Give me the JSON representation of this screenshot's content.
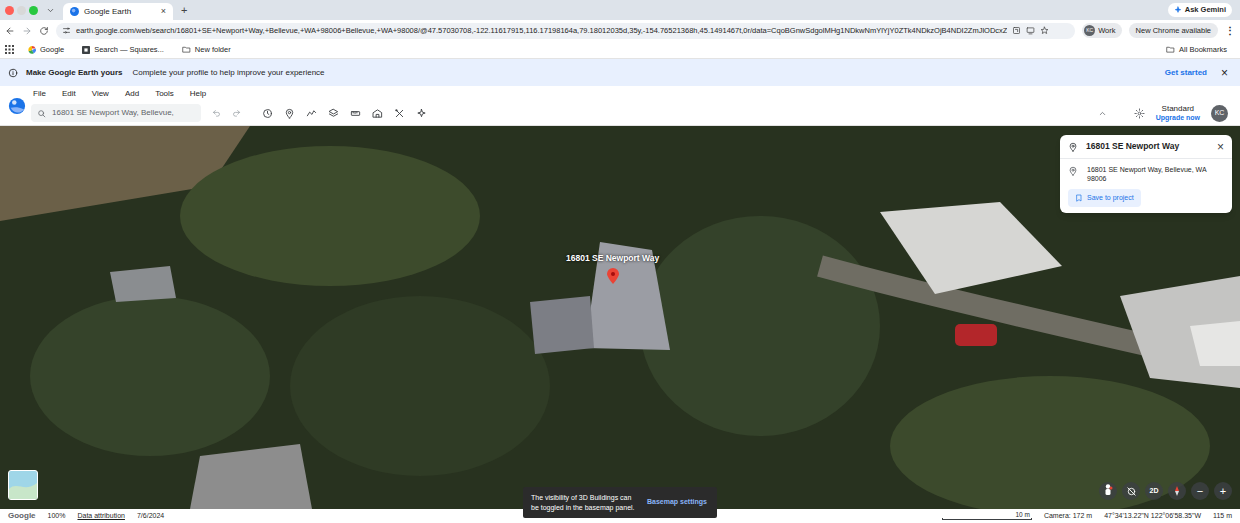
{
  "browser": {
    "tabs": [
      {
        "label": "Google Earth",
        "selected": true
      }
    ],
    "tab_close": "×",
    "new_tab": "+",
    "ask_gemini": "Ask Gemini",
    "url": "earth.google.com/web/search/16801+SE+Newport+Way,+Bellevue,+WA+98006+Bellevue,+WA+98008/@47.57030708,-122.11617915,116.17198164a,79.18012035d,35y,-154.76521368h,45.1491467t,0r/data=CqoBGnwSdgolMHg1NDkwNmYlYjY0ZTk4NDkzOjB4NDI2ZmJlODcxZ",
    "profile": {
      "initials": "KC",
      "label": "Work"
    },
    "update": "New Chrome available",
    "menu": "⋮",
    "bookmarks": [
      {
        "label": "Google"
      },
      {
        "label": "Search — Squares..."
      },
      {
        "label": "New folder"
      }
    ],
    "all_bookmarks": "All Bookmarks"
  },
  "banner": {
    "title": "Make Google Earth yours",
    "text": "Complete your profile to help improve your experience",
    "action": "Get started",
    "close": "×"
  },
  "menu": [
    "File",
    "Edit",
    "View",
    "Add",
    "Tools",
    "Help"
  ],
  "search": {
    "value": "16801 SE Newport Way, Bellevue,"
  },
  "account": {
    "plan": "Standard",
    "upgrade": "Upgrade now",
    "initials": "KC"
  },
  "map": {
    "pin_label": "16801 SE Newport Way"
  },
  "place_panel": {
    "title": "16801 SE Newport Way",
    "close": "×",
    "address": "16801 SE Newport Way, Bellevue, WA 98006",
    "save": "Save to project"
  },
  "toast": {
    "text": "The visibility of 3D Buildings can be toggled in the basemap panel.",
    "action": "Basemap settings"
  },
  "map_controls": {
    "mode": "2D",
    "zoom_out": "−",
    "zoom_in": "+"
  },
  "status_bar": {
    "brand": "Google",
    "zoom": "100%",
    "attribution": "Data attribution",
    "date": "7/6/2024",
    "scale": "10 m",
    "camera": "Camera: 172 m",
    "coords": "47°34'13.22\"N 122°06'58.35\"W",
    "elevation": "115 m"
  }
}
